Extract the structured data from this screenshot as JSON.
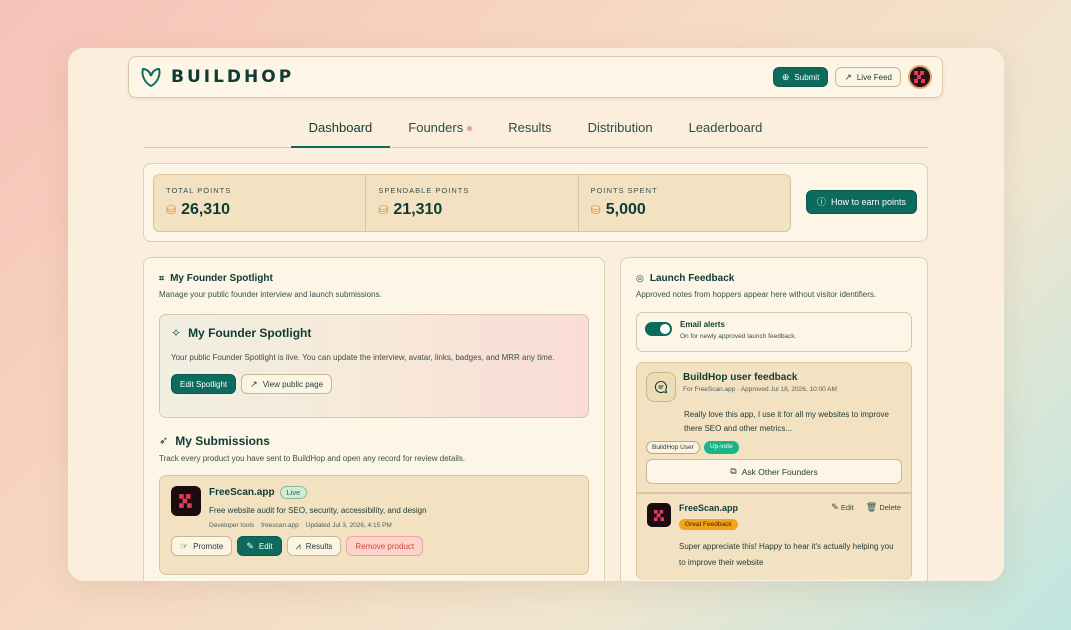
{
  "brand": {
    "name": "BUILDHOP"
  },
  "nav": {
    "submit_label": "Submit",
    "livefeed_label": "Live Feed"
  },
  "tabs": [
    {
      "label": "Dashboard"
    },
    {
      "label": "Founders"
    },
    {
      "label": "Results"
    },
    {
      "label": "Distribution"
    },
    {
      "label": "Leaderboard"
    }
  ],
  "points": {
    "total_label": "TOTAL POINTS",
    "total_value": "26,310",
    "spendable_label": "SPENDABLE POINTS",
    "spendable_value": "21,310",
    "spent_label": "POINTS SPENT",
    "spent_value": "5,000",
    "earn_label": "How to earn points"
  },
  "spotlight_section": {
    "title": "My Founder Spotlight",
    "subtitle": "Manage your public founder interview and launch submissions.",
    "card_title": "My Founder Spotlight",
    "card_text": "Your public Founder Spotlight is live. You can update the interview, avatar, links, badges, and MRR any time.",
    "edit_label": "Edit Spotlight",
    "view_label": "View public page"
  },
  "submissions": {
    "title": "My Submissions",
    "subtitle": "Track every product you have sent to BuildHop and open any record for review details.",
    "product": {
      "name": "FreeScan.app",
      "status": "Live",
      "description": "Free website audit for SEO, security, accessibility, and design",
      "category": "Developer tools",
      "domain": "freescan.app",
      "updated": "Updated Jul 3, 2026, 4:15 PM",
      "promote_label": "Promote",
      "edit_label": "Edit",
      "results_label": "Results",
      "remove_label": "Remove product"
    }
  },
  "feedback": {
    "title": "Launch Feedback",
    "subtitle": "Approved notes from hoppers appear here without visitor identifiers.",
    "alerts_title": "Email alerts",
    "alerts_sub": "On for newly approved launch feedback.",
    "card_title": "BuildHop user feedback",
    "card_meta": "For FreeScan.app · Approved Jul 18, 2026, 10:00 AM",
    "card_text": "Really love this app, I use it for all my websites to improve there SEO and other metrics...",
    "tag_user": "BuildHop User",
    "tag_vote": "Up-vote",
    "ask_label": "Ask Other Founders",
    "reply_name": "FreeScan.app",
    "reply_badge": "Great Feedback",
    "reply_edit": "Edit",
    "reply_delete": "Delete",
    "reply_text": "Super appreciate this! Happy to hear it's actually helping you to improve their website"
  }
}
